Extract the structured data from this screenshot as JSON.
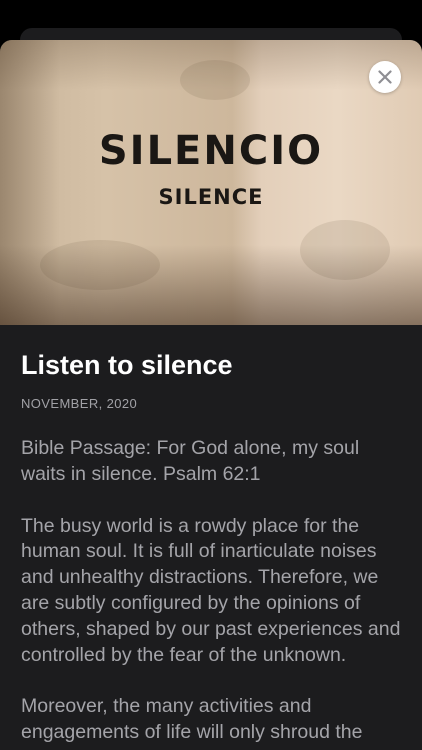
{
  "hero": {
    "sign_main": "SILENCIO",
    "sign_sub": "SILENCE",
    "close_icon": "close-icon"
  },
  "article": {
    "title": "Listen to silence",
    "date": "NOVEMBER, 2020",
    "paragraphs": [
      "Bible Passage: For God alone, my soul waits in silence. Psalm 62:1",
      "The busy world is a rowdy place for the human soul. It is full of inarticulate noises and unhealthy distractions. Therefore, we are subtly configured by the opinions of others, shaped by our past experiences and controlled by the fear of the unknown.",
      "Moreover, the many activities and engagements of life will only shroud the"
    ]
  },
  "colors": {
    "background": "#000000",
    "sheet": "#1c1c1e",
    "title": "#ffffff",
    "body_text": "#a4a4a9",
    "close_button": "#ffffff"
  }
}
